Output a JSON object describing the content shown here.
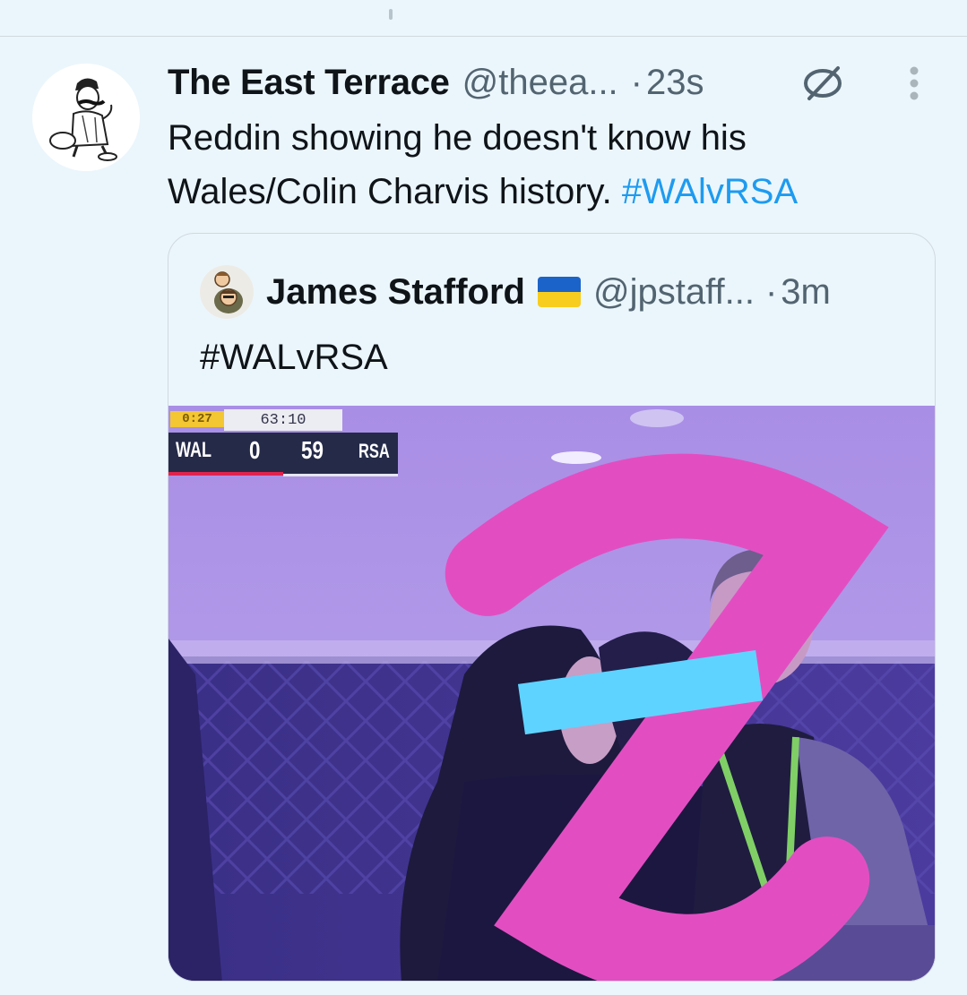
{
  "tweet": {
    "display_name": "The East Terrace",
    "handle": "@theea...",
    "separator": "·",
    "time": "23s",
    "text_main": "Reddin showing he doesn't know his Wales/Colin Charvis history.",
    "hashtag": "#WAlvRSA",
    "icons": {
      "hide": "eye-slash-icon",
      "more": "vertical-ellipsis-icon"
    }
  },
  "quote": {
    "display_name": "James Stafford",
    "flag": "ukraine-flag",
    "handle": "@jpstaff...",
    "separator": "·",
    "time": "3m",
    "text": "#WALvRSA"
  },
  "scoreboard": {
    "clock": "0:27",
    "game_time": "63:10",
    "home_team": "WAL",
    "home_score": "0",
    "away_score": "59",
    "away_team": "RSA"
  },
  "colors": {
    "background": "#ebf6fc",
    "link": "#1d9bf0",
    "secondary_text": "#536471",
    "border": "#cfd9de"
  }
}
